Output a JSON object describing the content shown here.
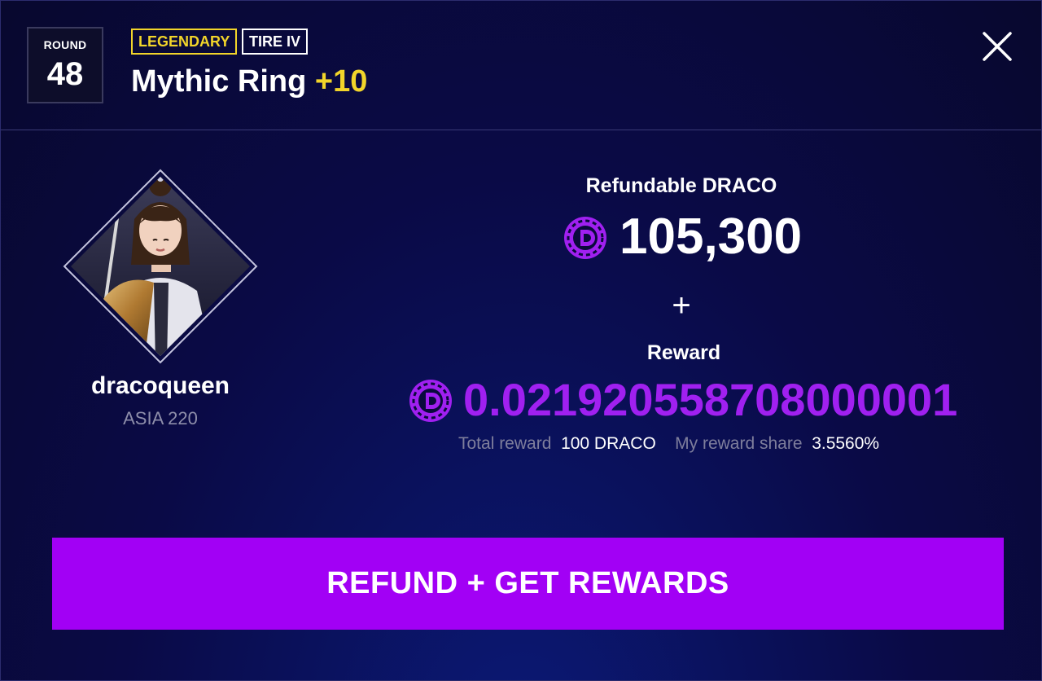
{
  "header": {
    "round_label": "ROUND",
    "round_number": "48",
    "badges": [
      "LEGENDARY",
      "TIRE IV"
    ],
    "item_name": "Mythic Ring",
    "item_level": "+10"
  },
  "player": {
    "username": "dracoqueen",
    "server": "ASIA 220"
  },
  "refund": {
    "label": "Refundable DRACO",
    "amount": "105,300"
  },
  "plus": "+",
  "reward": {
    "label": "Reward",
    "amount": "0.021920558708000001",
    "total_reward_label": "Total reward",
    "total_reward_value": "100 DRACO",
    "share_label": "My reward share",
    "share_value": "3.5560%"
  },
  "cta": {
    "label": "REFUND + GET REWARDS"
  },
  "icons": {
    "close": "close-icon",
    "coin": "draco-coin-icon"
  },
  "colors": {
    "accent": "#a200f5",
    "legendary": "#f2d52a",
    "background": "#0a0a3c",
    "reward": "#a020f0"
  }
}
